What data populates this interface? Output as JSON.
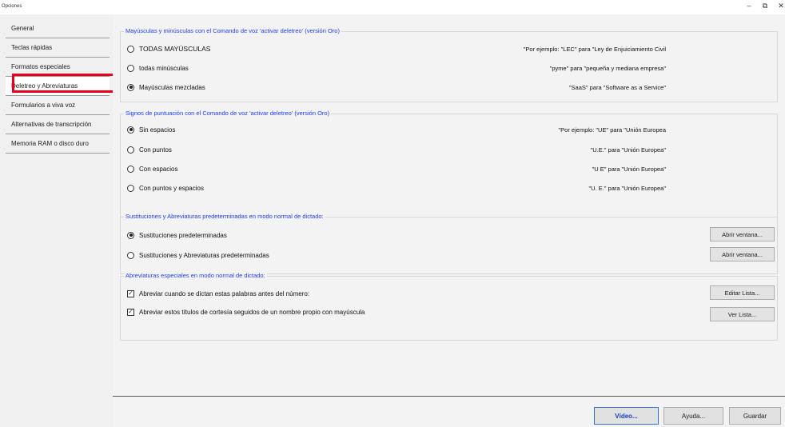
{
  "window": {
    "title": "Opciones"
  },
  "sidebar": {
    "items": [
      {
        "label": "General"
      },
      {
        "label": "Teclas rápidas"
      },
      {
        "label": "Formatos especiales"
      },
      {
        "label": "Deletreo y Abreviaturas"
      },
      {
        "label": "Formularios a viva voz"
      },
      {
        "label": "Alternativas de transcripción"
      },
      {
        "label": "Memoria RAM o disco duro"
      }
    ],
    "selected": "Deletreo y Abreviaturas"
  },
  "groups": {
    "caps": {
      "legend": "Mayúsculas y minúsculas con el Comando de voz 'activar deletreo' (versión Oro)",
      "options": [
        {
          "label": "TODAS MAYÚSCULAS",
          "example": "\"Por ejemplo: \"LEC\" para \"Ley de Enjuiciamiento Civil",
          "checked": false
        },
        {
          "label": "todas minúsculas",
          "example": "\"pyme\" para \"pequeña y mediana empresa\"",
          "checked": false
        },
        {
          "label": "Mayúsculas mezcladas",
          "example": "\"SaaS\" para \"Software as a Service\"",
          "checked": true
        }
      ]
    },
    "punct": {
      "legend": "Signos de puntuación con el Comando de voz 'activar deletreo' (versión Oro)",
      "options": [
        {
          "label": "Sin espacios",
          "example": "\"Por ejemplo: \"UE\" para \"Unión Europea",
          "checked": true
        },
        {
          "label": "Con puntos",
          "example": "\"U.E.\" para \"Unión Europea\"",
          "checked": false
        },
        {
          "label": "Con espacios",
          "example": "\"U E\" para \"Unión Europea\"",
          "checked": false
        },
        {
          "label": "Con puntos y espacios",
          "example": "\"U. E.\" para \"Unión Europea\"",
          "checked": false
        }
      ]
    },
    "subs": {
      "legend": "Sustituciones y Abreviaturas predeterminadas en modo normal de dictado:",
      "options": [
        {
          "label": "Sustituciones predeterminadas",
          "button": "Abrir ventana...",
          "checked": true
        },
        {
          "label": "Sustituciones y Abreviaturas predeterminadas",
          "button": "Abrir ventana...",
          "checked": false
        }
      ]
    },
    "abbr": {
      "legend": "Abreviaturas especiales en modo normal de dictado:",
      "options": [
        {
          "label": "Abreviar cuando se dictan estas palabras antes del número:",
          "button": "Editar Lista...",
          "checked": true
        },
        {
          "label": "Abreviar estos títulos de cortesía seguidos de un nombre propio con mayúscula",
          "button": "Ver Lista...",
          "checked": true
        }
      ]
    }
  },
  "footer": {
    "video": "Vídeo...",
    "help": "Ayuda...",
    "save": "Guardar"
  },
  "icons": {
    "minimize": "minimize-icon",
    "restore": "restore-icon",
    "close": "close-icon"
  },
  "colors": {
    "legend": "#1c3cff",
    "highlight": "#e8001c"
  }
}
